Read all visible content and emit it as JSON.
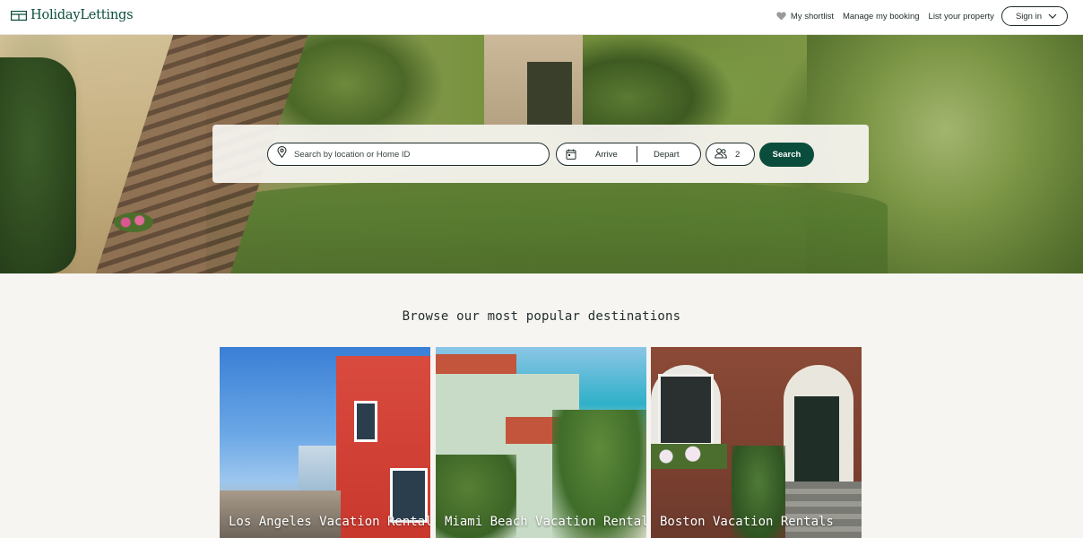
{
  "header": {
    "logo_text": "HolidayLettings",
    "nav": {
      "shortlist_label": "My shortlist",
      "manage_booking_label": "Manage my booking",
      "list_property_label": "List your property",
      "sign_in_label": "Sign in"
    }
  },
  "search": {
    "location_placeholder": "Search by location or Home ID",
    "arrive_label": "Arrive",
    "depart_label": "Depart",
    "guests_count": "2",
    "search_button_label": "Search"
  },
  "destinations": {
    "title": "Browse our most popular destinations",
    "cards": [
      {
        "label": "Los Angeles Vacation Rentals"
      },
      {
        "label": "Miami Beach Vacation Rentals"
      },
      {
        "label": "Boston Vacation Rentals"
      }
    ]
  },
  "colors": {
    "brand": "#0b4d3c",
    "page_background": "#f7f5f2",
    "text": "#1f2d2a"
  }
}
